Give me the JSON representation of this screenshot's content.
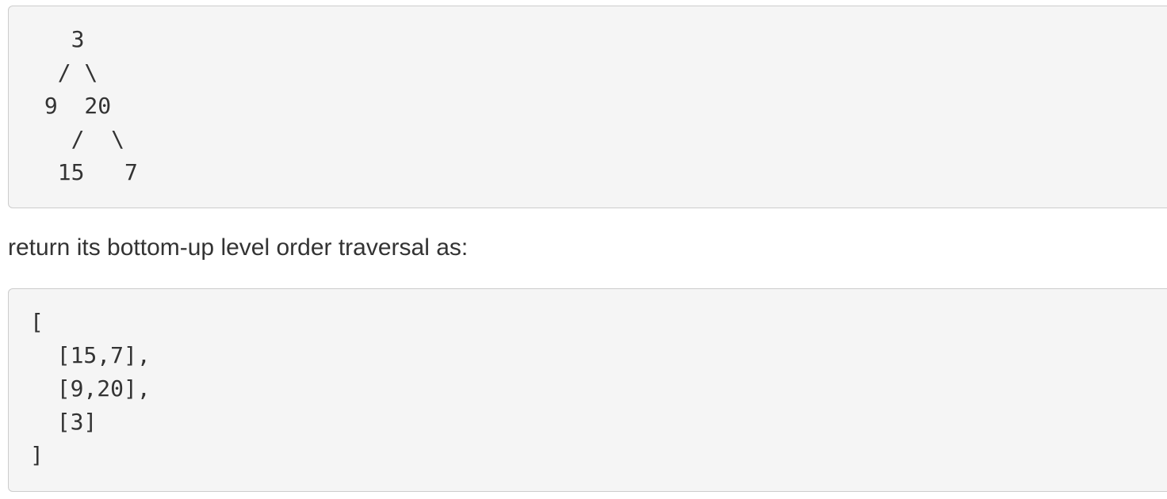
{
  "tree_example": {
    "lines": [
      "   3",
      "  / \\",
      " 9  20",
      "   /  \\",
      "  15   7"
    ]
  },
  "description": "return its bottom-up level order traversal as:",
  "result_example": {
    "lines": [
      "[",
      "  [15,7],",
      "  [9,20],",
      "  [3]",
      "]"
    ]
  }
}
